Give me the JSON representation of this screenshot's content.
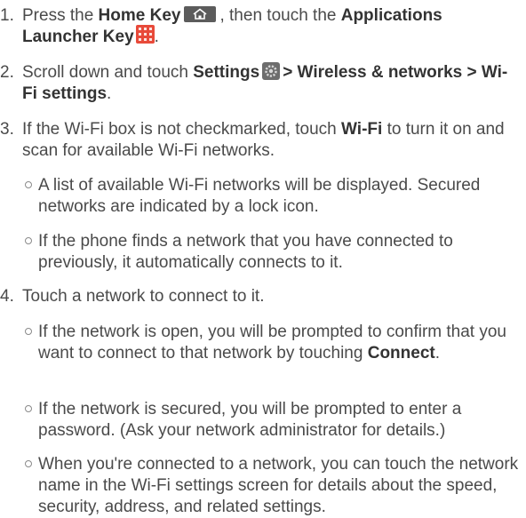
{
  "steps": [
    {
      "number": "1.",
      "text_a": "Press the ",
      "key_a": "Home Key",
      "text_b": ", then touch the ",
      "key_b": "Applications Launcher Key",
      "text_c": "."
    },
    {
      "number": "2.",
      "text_a": "Scroll down and touch ",
      "key_a": "Settings",
      "key_b": "> Wireless & networks > Wi-Fi settings",
      "text_c": "."
    },
    {
      "number": "3.",
      "text_a": "If the Wi-Fi box is not checkmarked, touch ",
      "key_a": "Wi-Fi",
      "text_b": " to turn it on and scan for available Wi-Fi networks.",
      "bullets": [
        "A list of available Wi-Fi networks will be displayed. Secured networks are indicated by a lock icon.",
        "If the phone finds a network that you have connected to previously, it automatically connects to it."
      ]
    },
    {
      "number": "4.",
      "text_a": "Touch a network to connect to it.",
      "bullet_1_text": "If the network is open, you will be prompted to confirm that you want to connect to that network by touching ",
      "bullet_1_key": "Connect",
      "bullet_1_end": ".",
      "bullets": [
        "If the network is secured, you will be prompted to enter a password. (Ask your network administrator for details.)",
        "When you're connected to a network, you can touch the network name in the Wi-Fi settings screen for details about the speed, security, address, and related settings."
      ]
    }
  ],
  "icons": {
    "home": "home-key-icon",
    "apps": "applications-launcher-key-icon",
    "settings": "settings-icon"
  },
  "colors": {
    "text": "#4a4a4a",
    "apps_icon": "#e84a3a",
    "home_icon": "#5c5c5c"
  }
}
